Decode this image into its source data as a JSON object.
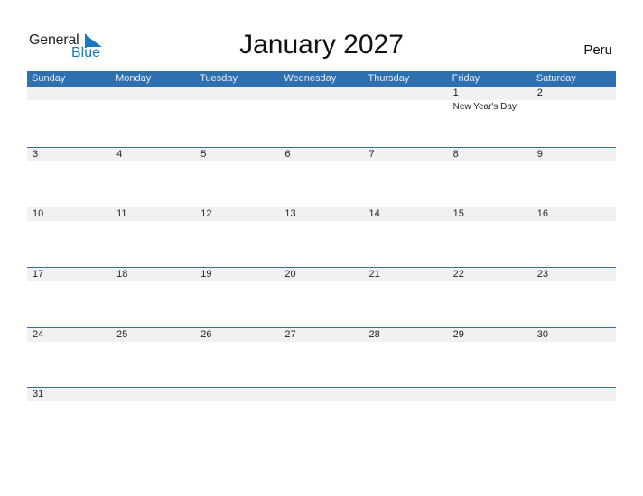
{
  "brand": {
    "word1": "General",
    "word2": "Blue",
    "color": "#1a78c2"
  },
  "title": "January 2027",
  "country": "Peru",
  "colors": {
    "header_bg": "#2e6fb0",
    "band_bg": "#f1f1f1"
  },
  "weekdays": [
    "Sunday",
    "Monday",
    "Tuesday",
    "Wednesday",
    "Thursday",
    "Friday",
    "Saturday"
  ],
  "weeks": [
    [
      {
        "day": "",
        "event": ""
      },
      {
        "day": "",
        "event": ""
      },
      {
        "day": "",
        "event": ""
      },
      {
        "day": "",
        "event": ""
      },
      {
        "day": "",
        "event": ""
      },
      {
        "day": "1",
        "event": "New Year's Day"
      },
      {
        "day": "2",
        "event": ""
      }
    ],
    [
      {
        "day": "3",
        "event": ""
      },
      {
        "day": "4",
        "event": ""
      },
      {
        "day": "5",
        "event": ""
      },
      {
        "day": "6",
        "event": ""
      },
      {
        "day": "7",
        "event": ""
      },
      {
        "day": "8",
        "event": ""
      },
      {
        "day": "9",
        "event": ""
      }
    ],
    [
      {
        "day": "10",
        "event": ""
      },
      {
        "day": "11",
        "event": ""
      },
      {
        "day": "12",
        "event": ""
      },
      {
        "day": "13",
        "event": ""
      },
      {
        "day": "14",
        "event": ""
      },
      {
        "day": "15",
        "event": ""
      },
      {
        "day": "16",
        "event": ""
      }
    ],
    [
      {
        "day": "17",
        "event": ""
      },
      {
        "day": "18",
        "event": ""
      },
      {
        "day": "19",
        "event": ""
      },
      {
        "day": "20",
        "event": ""
      },
      {
        "day": "21",
        "event": ""
      },
      {
        "day": "22",
        "event": ""
      },
      {
        "day": "23",
        "event": ""
      }
    ],
    [
      {
        "day": "24",
        "event": ""
      },
      {
        "day": "25",
        "event": ""
      },
      {
        "day": "26",
        "event": ""
      },
      {
        "day": "27",
        "event": ""
      },
      {
        "day": "28",
        "event": ""
      },
      {
        "day": "29",
        "event": ""
      },
      {
        "day": "30",
        "event": ""
      }
    ],
    [
      {
        "day": "31",
        "event": ""
      },
      {
        "day": "",
        "event": ""
      },
      {
        "day": "",
        "event": ""
      },
      {
        "day": "",
        "event": ""
      },
      {
        "day": "",
        "event": ""
      },
      {
        "day": "",
        "event": ""
      },
      {
        "day": "",
        "event": ""
      }
    ]
  ]
}
